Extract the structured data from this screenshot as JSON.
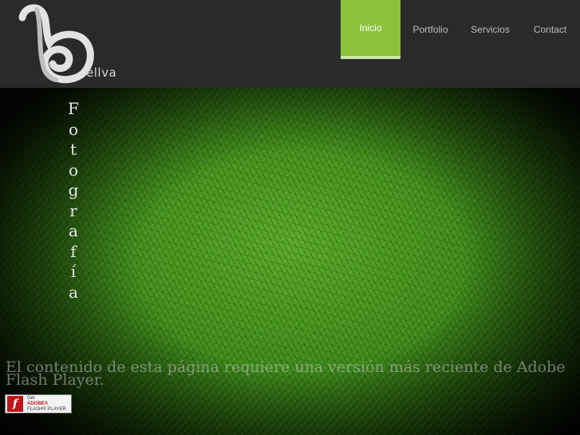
{
  "logo": {
    "text": "ellva",
    "icon": "stylized-b-logo"
  },
  "nav": {
    "items": [
      {
        "label": "Inicio",
        "active": true
      },
      {
        "label": "Portfolio",
        "active": false
      },
      {
        "label": "Servicios",
        "active": false
      },
      {
        "label": "Contact",
        "active": false
      }
    ]
  },
  "hero": {
    "vertical_title": [
      "F",
      "o",
      "t",
      "o",
      "g",
      "r",
      "a",
      "f",
      "í",
      "a"
    ],
    "flash_message": "El contenido de esta página requiere una versión más reciente de Adobe Flash Player.",
    "flash_badge": {
      "line1": "Get",
      "line2": "ADOBE®",
      "line3": "FLASH® PLAYER",
      "icon": "flash-player-icon"
    }
  },
  "colors": {
    "accent": "#8bc23c",
    "header_bg": "#2a2a2a"
  }
}
